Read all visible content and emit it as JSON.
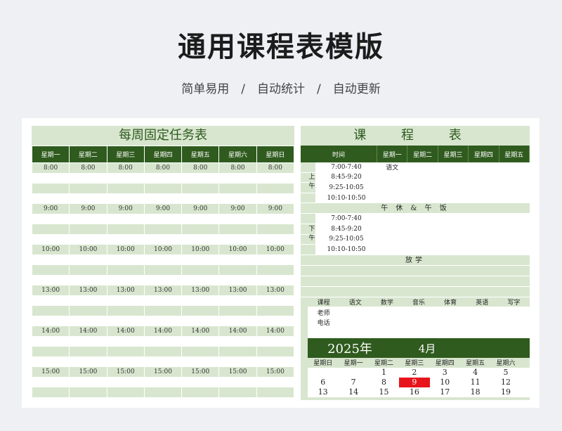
{
  "header": {
    "title": "通用课程表模版",
    "subtitle": "简单易用　/　自动统计　/　自动更新"
  },
  "tasks": {
    "title": "每周固定任务表",
    "days": [
      "星期一",
      "星期二",
      "星期三",
      "星期四",
      "星期五",
      "星期六",
      "星期日"
    ],
    "times": [
      "8:00",
      "9:00",
      "10:00",
      "13:00",
      "14:00",
      "15:00"
    ]
  },
  "schedule": {
    "title": "课 程 表",
    "time_header": "时间",
    "days": [
      "星期一",
      "星期二",
      "星期三",
      "星期四",
      "星期五"
    ],
    "am_label": "上午",
    "pm_label": "下午",
    "am_slots": [
      "7:00-7:40",
      "8:45-9:20",
      "9:25-10:05",
      "10:10-10:50"
    ],
    "pm_slots": [
      "7:00-7:40",
      "8:45-9:20",
      "9:25-10:05",
      "10:10-10:50"
    ],
    "first_entry": "语文",
    "lunch": "午 休 & 午 饭",
    "dismiss": "放学",
    "info_headers": [
      "课程",
      "语文",
      "数学",
      "音乐",
      "体育",
      "英语",
      "写字"
    ],
    "teacher_label": "老师",
    "phone_label": "电话"
  },
  "calendar": {
    "year": "2025年",
    "month": "4月",
    "weekdays": [
      "星期日",
      "星期一",
      "星期二",
      "星期三",
      "星期四",
      "星期五",
      "星期六"
    ],
    "weeks": [
      [
        "",
        "",
        "1",
        "2",
        "3",
        "4",
        "5"
      ],
      [
        "6",
        "7",
        "8",
        "9",
        "10",
        "11",
        "12"
      ],
      [
        "13",
        "14",
        "15",
        "16",
        "17",
        "18",
        "19"
      ]
    ],
    "today": "9",
    "today_color": "#e8141b"
  },
  "colors": {
    "dark_green": "#2f5b1e",
    "light_green": "#d8e6cf"
  }
}
